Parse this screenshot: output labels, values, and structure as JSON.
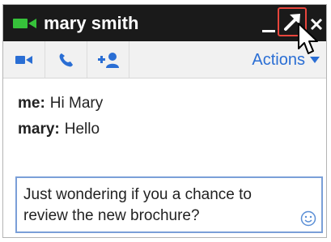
{
  "window": {
    "title": "mary smith",
    "accent": "#2a6ed4",
    "titlebar_bg": "#1a1a1a",
    "highlight": "#e8453c"
  },
  "titlebar": {
    "status_icon": "video-camera-status-icon",
    "buttons": [
      "minimize",
      "pop-out",
      "close"
    ],
    "popout_highlighted": true
  },
  "toolbar": {
    "tools": [
      "video-call",
      "voice-call",
      "add-person"
    ],
    "actions_label": "Actions"
  },
  "messages": [
    {
      "sender": "me:",
      "text": "Hi Mary"
    },
    {
      "sender": "mary:",
      "text": "Hello"
    }
  ],
  "compose": {
    "value": "Just wondering if you a chance to review the new brochure?"
  }
}
